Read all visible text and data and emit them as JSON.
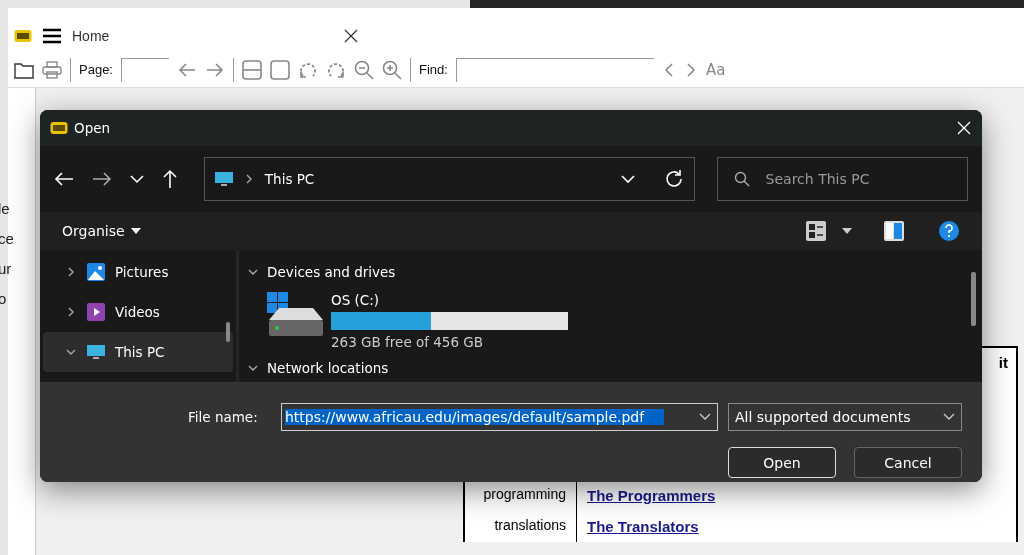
{
  "app": {
    "tab_title": "Home",
    "page_label": "Page:",
    "find_label": "Find:",
    "case_glyph": "Aa"
  },
  "document": {
    "fragments": [
      "le",
      "ce",
      "ur",
      "o"
    ],
    "table": {
      "header_fragment": "it",
      "rows": [
        {
          "label": "programming",
          "link": "The Programmers"
        },
        {
          "label": "translations",
          "link": "The Translators"
        }
      ]
    }
  },
  "dialog": {
    "title": "Open",
    "address": "This PC",
    "search_placeholder": "Search This PC",
    "organise": "Organise",
    "nav_items": [
      {
        "kind": "pictures",
        "label": "Pictures",
        "expanded": false,
        "selected": false
      },
      {
        "kind": "videos",
        "label": "Videos",
        "expanded": false,
        "selected": false
      },
      {
        "kind": "computer",
        "label": "This PC",
        "expanded": true,
        "selected": true
      }
    ],
    "sections": [
      {
        "title": "Devices and drives",
        "expanded": true,
        "drives": [
          {
            "name": "OS (C:)",
            "level": 0.42,
            "free_text": "263 GB free of 456 GB"
          }
        ]
      },
      {
        "title": "Network locations",
        "expanded": true
      }
    ],
    "file_name_label": "File name:",
    "file_name": "https://www.africau.edu/images/default/sample.pdf",
    "file_type": "All supported documents",
    "buttons": [
      {
        "label": "Open",
        "default": true
      },
      {
        "label": "Cancel",
        "default": false
      }
    ]
  }
}
